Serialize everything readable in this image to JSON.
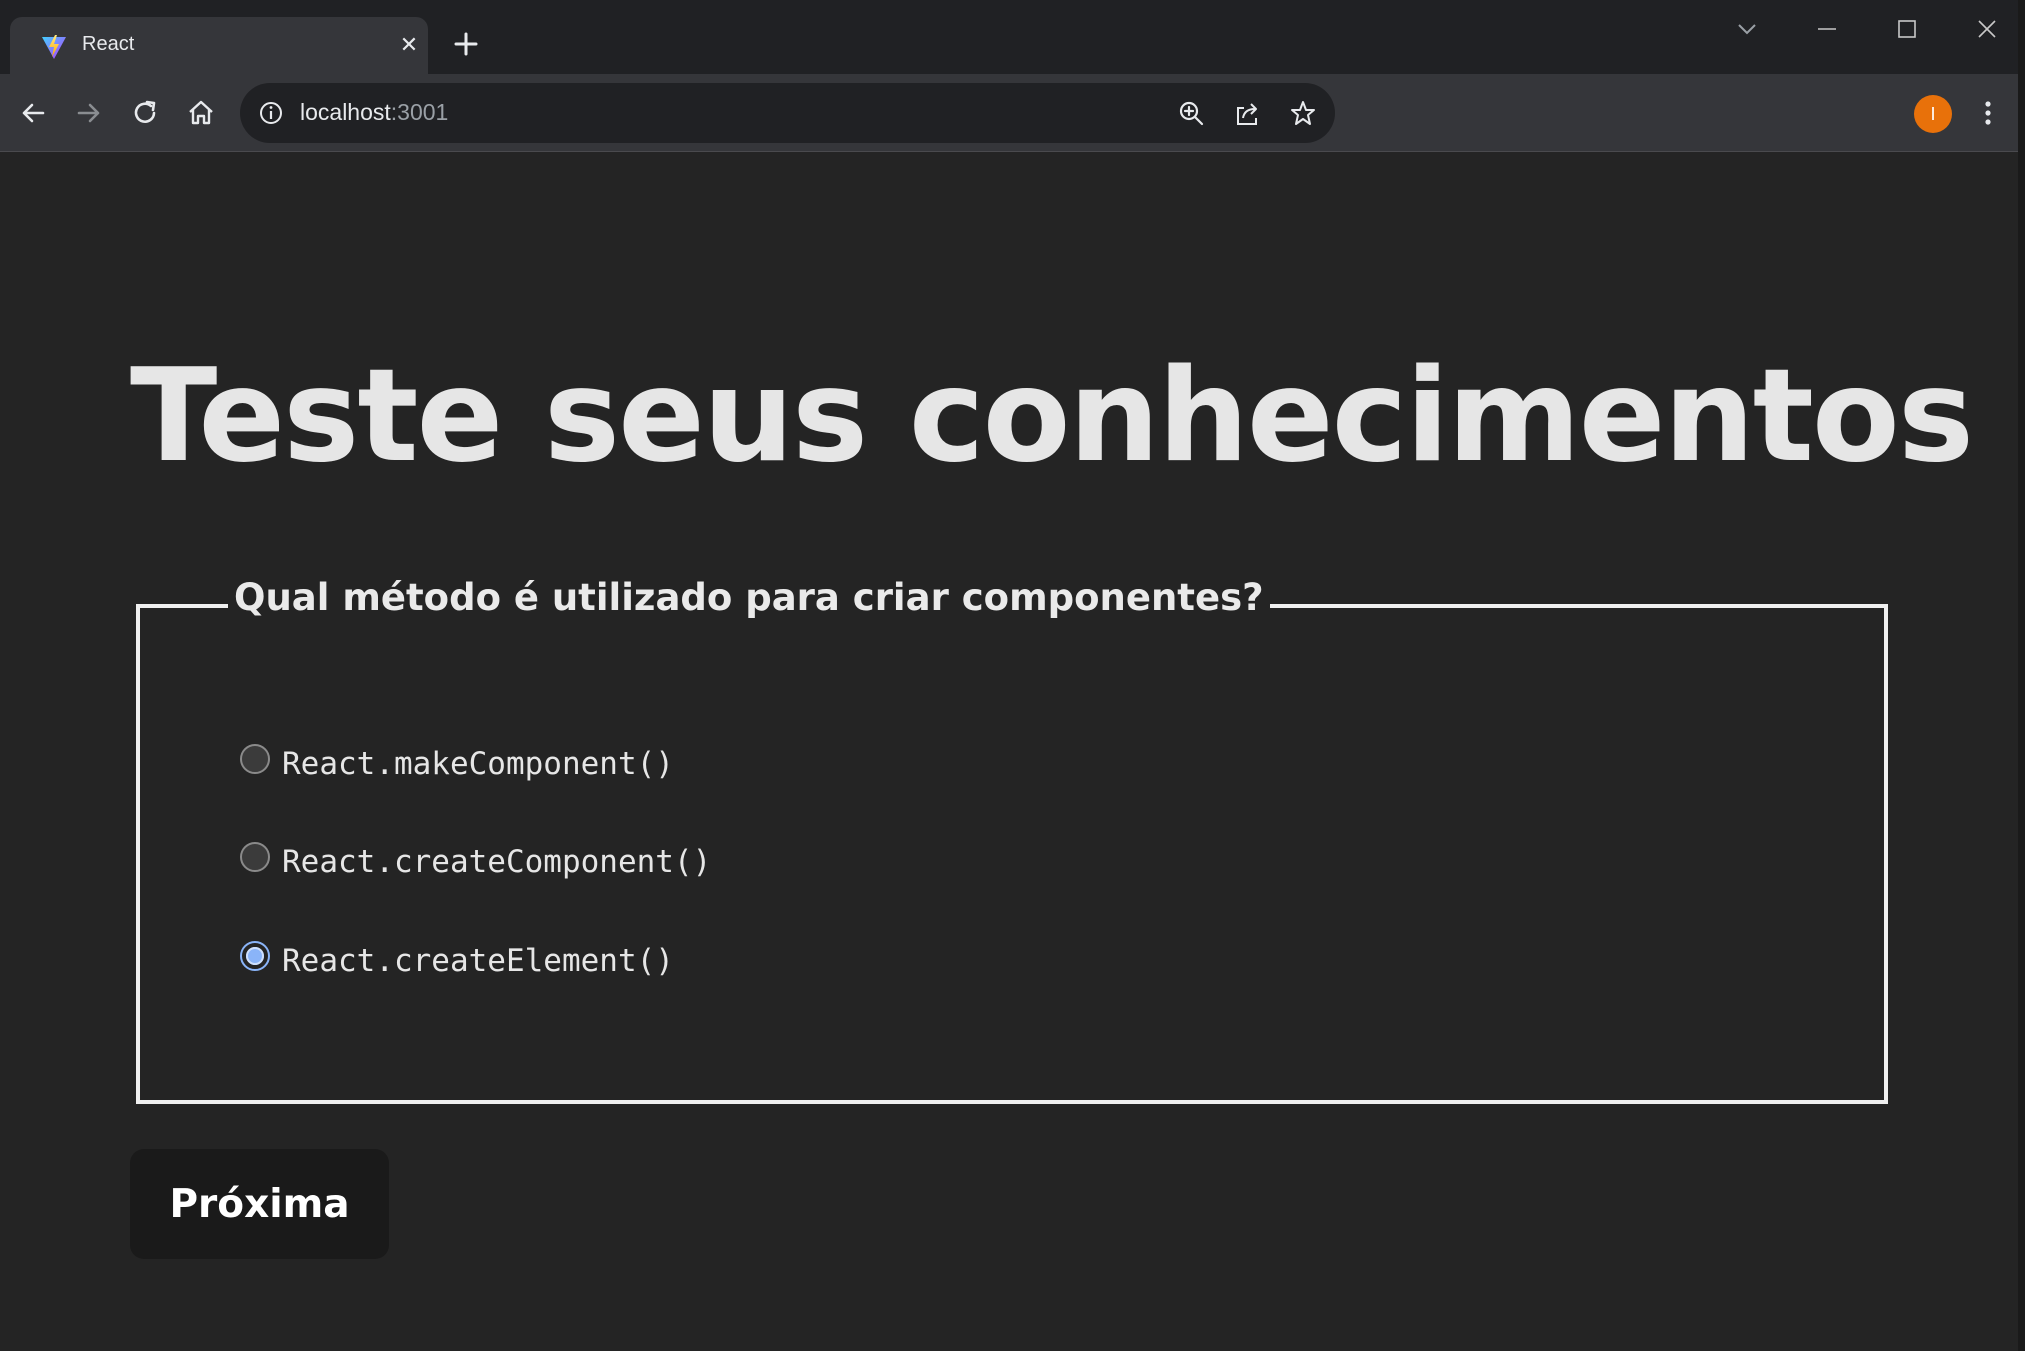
{
  "browser": {
    "tab": {
      "title": "React"
    },
    "address": {
      "host": "localhost",
      "port": ":3001"
    },
    "profile_initial": "I"
  },
  "page": {
    "title": "Teste seus conhecimentos",
    "question": "Qual método é utilizado para criar componentes?",
    "options": [
      {
        "label": "React.makeComponent()",
        "selected": false
      },
      {
        "label": "React.createComponent()",
        "selected": false
      },
      {
        "label": "React.createElement()",
        "selected": true
      }
    ],
    "next_button": "Próxima"
  },
  "colors": {
    "background": "#242424",
    "text": "#e6e6e6",
    "radio_accent": "#8ab4f8",
    "avatar": "#e8710a",
    "button_bg": "#1a1a1a"
  }
}
